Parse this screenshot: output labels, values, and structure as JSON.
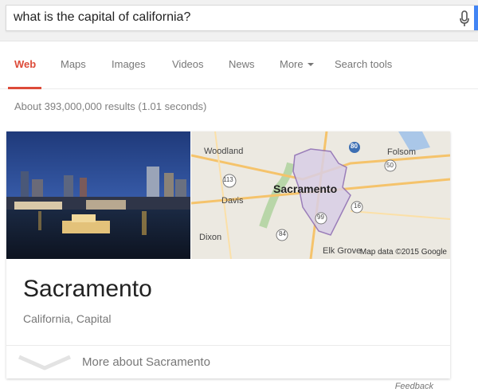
{
  "search": {
    "query": "what is the capital of california?",
    "mic_icon": "microphone-icon"
  },
  "tabs": [
    {
      "label": "Web",
      "active": true
    },
    {
      "label": "Maps",
      "active": false
    },
    {
      "label": "Images",
      "active": false
    },
    {
      "label": "Videos",
      "active": false
    },
    {
      "label": "News",
      "active": false
    },
    {
      "label": "More",
      "active": false
    },
    {
      "label": "Search tools",
      "active": false
    }
  ],
  "stats": "About 393,000,000 results (1.01 seconds)",
  "knowledge_card": {
    "title": "Sacramento",
    "subtitle": "California, Capital",
    "more_label": "More about Sacramento",
    "map": {
      "labels": [
        "Woodland",
        "Folsom",
        "Sacramento",
        "Davis",
        "Dixon",
        "Elk Grove"
      ],
      "highways": [
        "80",
        "50",
        "113",
        "16",
        "99",
        "84"
      ],
      "credit": "Map data ©2015 Google"
    }
  },
  "feedback": "Feedback",
  "colors": {
    "accent_red": "#dd4b39",
    "blue_edge": "#4285f4",
    "muted_text": "#777777"
  }
}
